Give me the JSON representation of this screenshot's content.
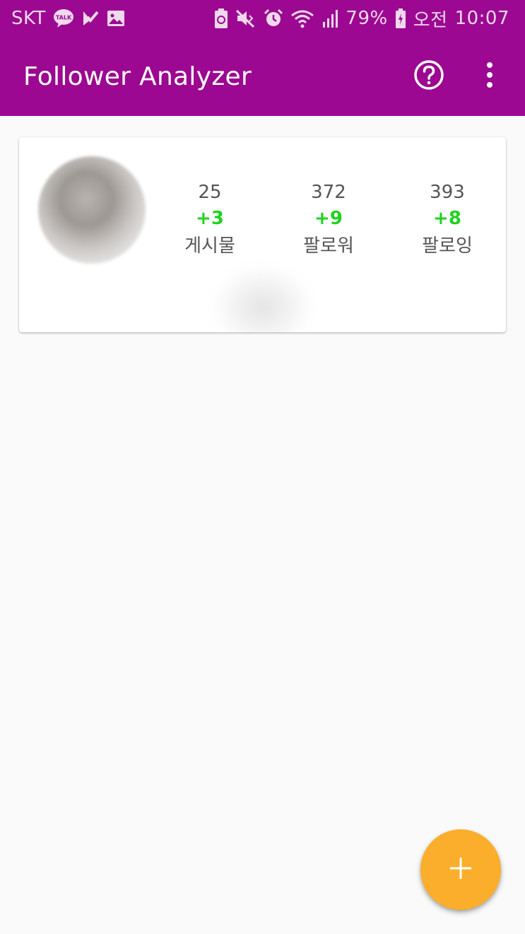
{
  "status_bar": {
    "carrier": "SKT",
    "talk_badge": "TALK",
    "battery_percent": "79%",
    "period": "오전",
    "time": "10:07",
    "icons": [
      "kakaotalk-icon",
      "check-flag-icon",
      "gallery-icon",
      "battery-saver-icon",
      "mute-icon",
      "alarm-icon",
      "wifi-icon",
      "signal-icon",
      "battery-icon"
    ]
  },
  "app_bar": {
    "title": "Follower Analyzer",
    "actions": [
      "help-icon",
      "overflow-menu-icon"
    ]
  },
  "profile": {
    "stats": [
      {
        "count": "25",
        "delta": "+3",
        "label": "게시물"
      },
      {
        "count": "372",
        "delta": "+9",
        "label": "팔로워"
      },
      {
        "count": "393",
        "delta": "+8",
        "label": "팔로잉"
      }
    ]
  },
  "fab": {
    "icon": "add-icon"
  },
  "colors": {
    "primary": "#9c0891",
    "accent": "#fbae2c",
    "positive_delta": "#1fd31f",
    "background": "#fafafa"
  }
}
